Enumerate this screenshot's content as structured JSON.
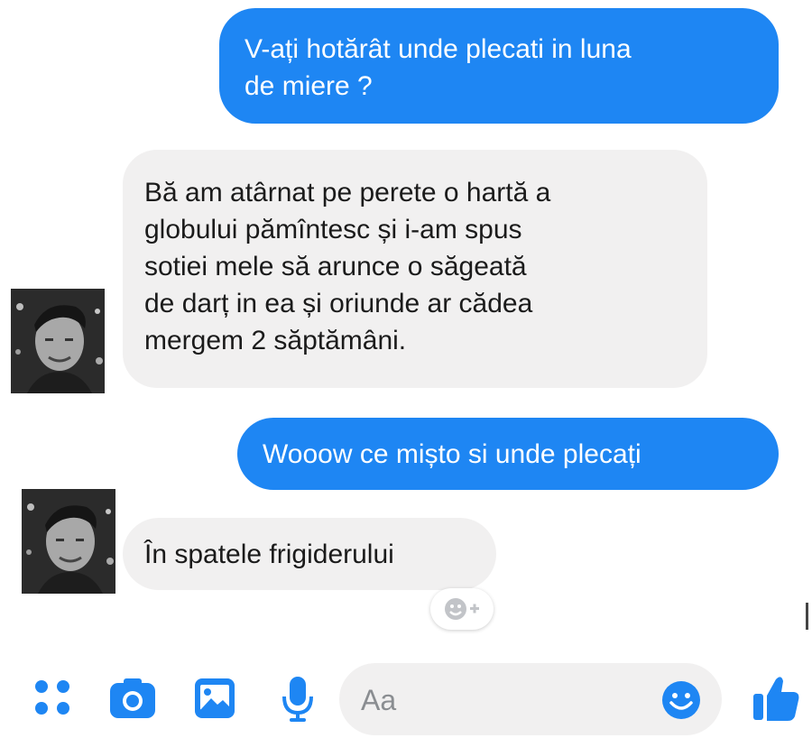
{
  "messages": [
    {
      "direction": "outgoing",
      "text": "V-ați hotărât unde plecati in luna\nde miere ?"
    },
    {
      "direction": "incoming",
      "text": "Bă am atârnat pe perete o hartă a\nglobului pămîntesc și i-am spus\nsotiei mele să arunce o săgeată\nde darț in ea și oriunde ar cădea\nmergem 2 săptămâni."
    },
    {
      "direction": "outgoing",
      "text": "Wooow ce mișto si unde plecați"
    },
    {
      "direction": "incoming",
      "text": "În spatele frigiderului"
    }
  ],
  "composer": {
    "placeholder": "Aa"
  },
  "icons": {
    "toolbar": [
      "more-apps-icon",
      "camera-icon",
      "gallery-icon",
      "microphone-icon"
    ],
    "emoji": "emoji-icon",
    "send": "thumbs-up-icon",
    "reaction": "add-reaction-icon"
  },
  "colors": {
    "accent": "#1e86f3",
    "incoming_bubble": "#f1f0f0",
    "outgoing_text": "#ffffff",
    "incoming_text": "#1b1b1b"
  }
}
